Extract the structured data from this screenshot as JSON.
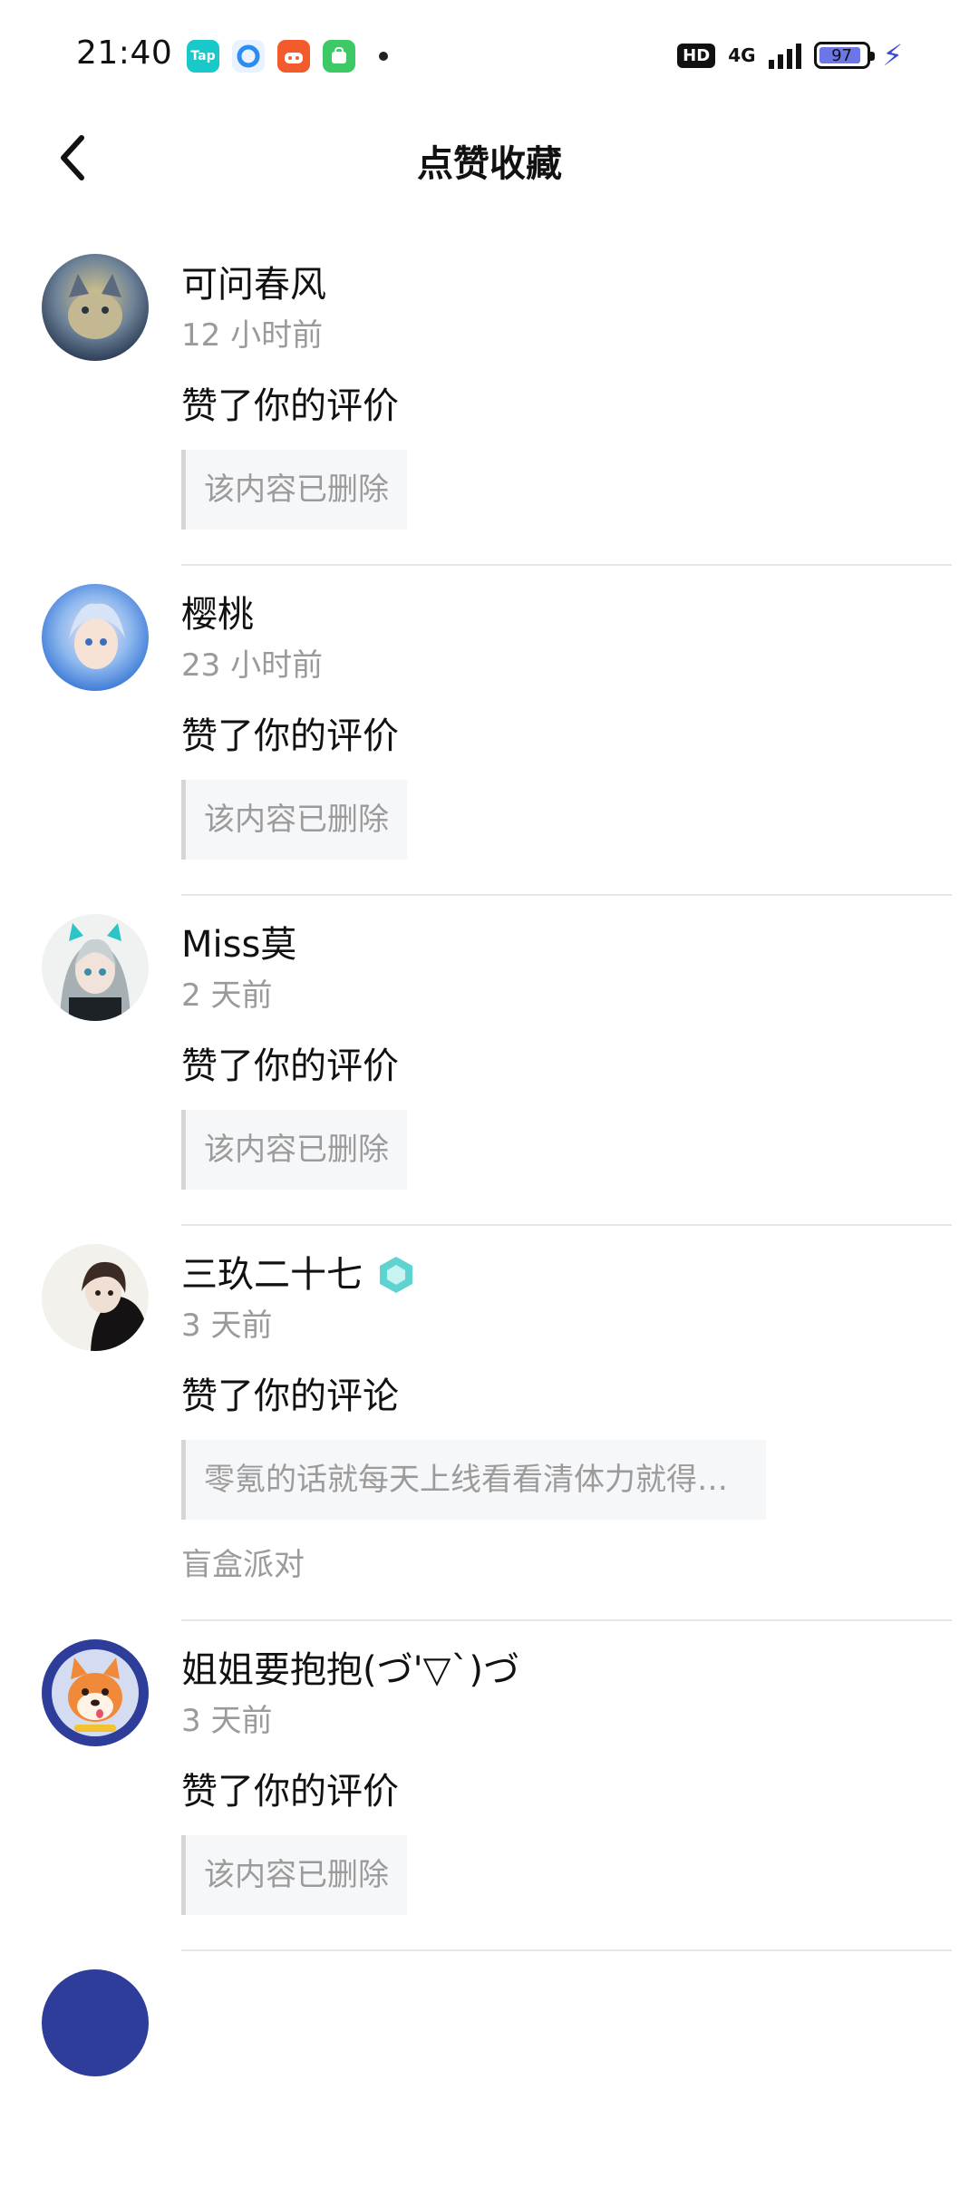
{
  "status_bar": {
    "time": "21:40",
    "app_icons": [
      "tap-icon",
      "browser-icon",
      "game-icon",
      "store-icon"
    ],
    "hd_label": "HD",
    "network": "4G",
    "battery": "97"
  },
  "header": {
    "title": "点赞收藏"
  },
  "items": [
    {
      "name": "可问春风",
      "time": "12 小时前",
      "action": "赞了你的评价",
      "quote": "该内容已删除",
      "avatar_color": "#7f93a6"
    },
    {
      "name": "樱桃",
      "time": "23 小时前",
      "action": "赞了你的评价",
      "quote": "该内容已删除",
      "avatar_color": "#4a8fe0"
    },
    {
      "name": "Miss莫",
      "time": "2 天前",
      "action": "赞了你的评价",
      "quote": "该内容已删除",
      "avatar_color": "#9aa7ad"
    },
    {
      "name": "三玖二十七",
      "time": "3 天前",
      "action": "赞了你的评论",
      "quote": "零氪的话就每天上线看看清体力就得了，抽就...",
      "tag": "盲盒派对",
      "avatar_color": "#2b2522",
      "badge_color": "#5fd3d0"
    },
    {
      "name": "姐姐要抱抱(づ'▽`)づ",
      "time": "3 天前",
      "action": "赞了你的评价",
      "quote": "该内容已删除",
      "avatar_color": "#2d3d99"
    }
  ]
}
